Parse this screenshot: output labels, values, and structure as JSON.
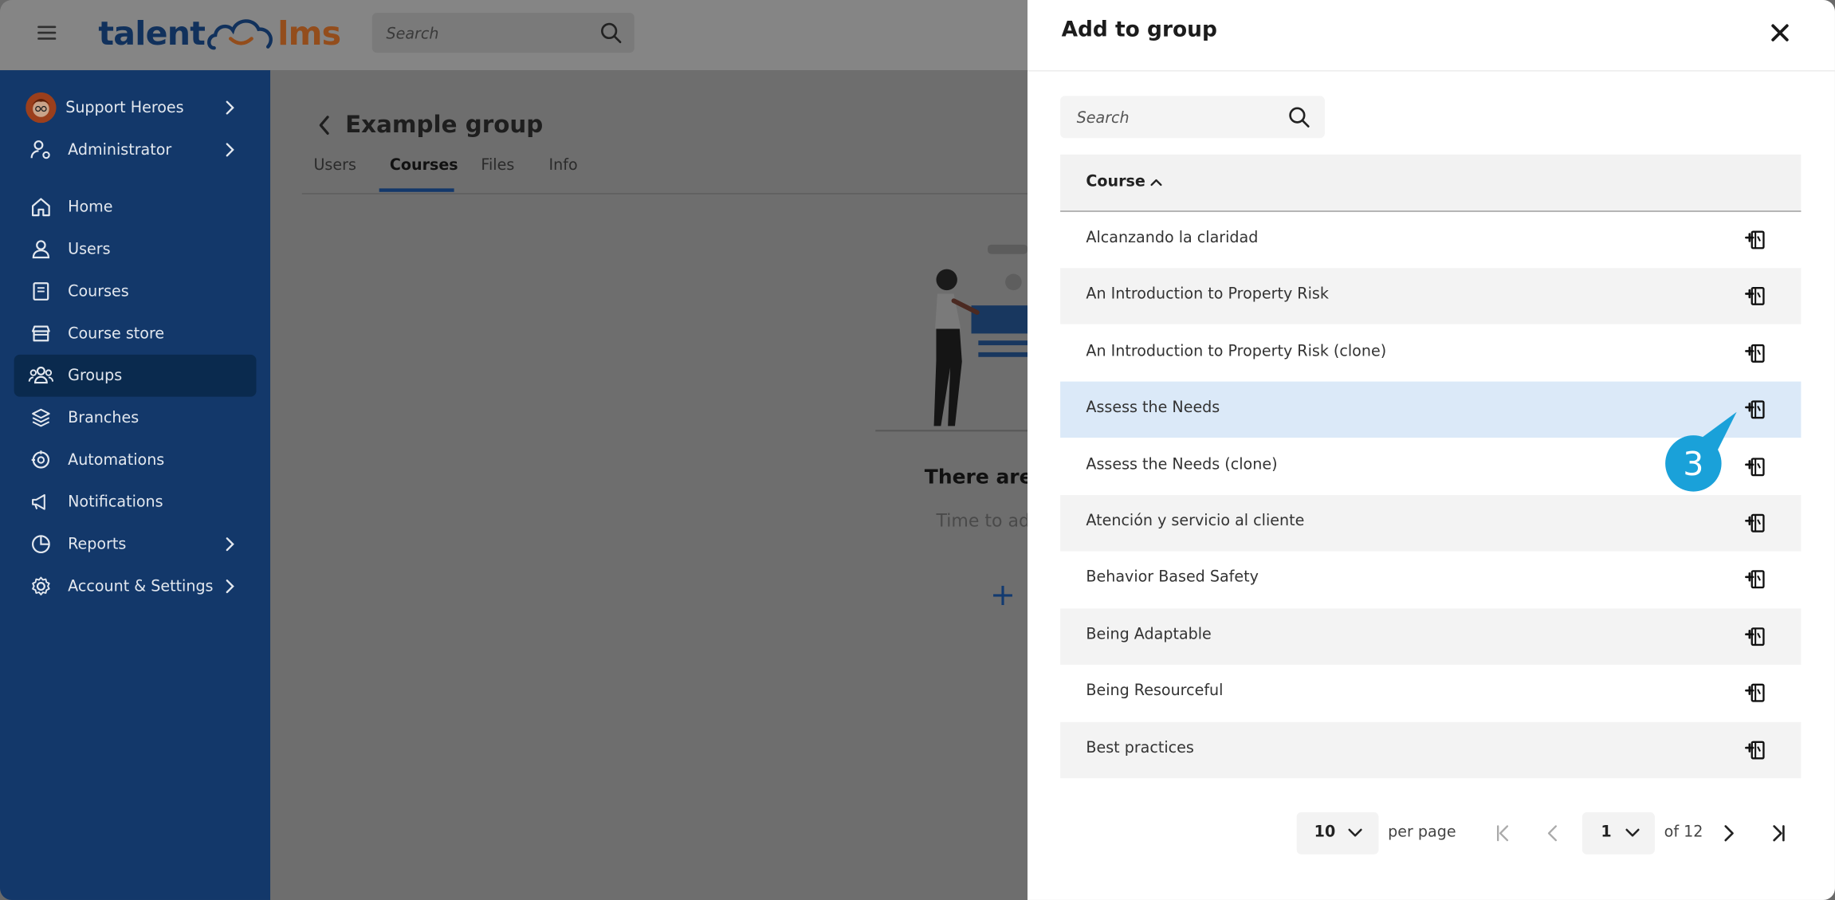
{
  "topbar": {
    "logo_talent": "talent",
    "logo_lms": "lms",
    "search_placeholder": "Search"
  },
  "sidebar": {
    "items": [
      {
        "label": "Support Heroes",
        "icon": "avatar",
        "chevron": true
      },
      {
        "label": "Administrator",
        "icon": "user-gear-icon",
        "chevron": true
      },
      {
        "label": "Home",
        "icon": "home-icon",
        "chevron": false
      },
      {
        "label": "Users",
        "icon": "user-icon",
        "chevron": false
      },
      {
        "label": "Courses",
        "icon": "book-icon",
        "chevron": false
      },
      {
        "label": "Course store",
        "icon": "store-icon",
        "chevron": false
      },
      {
        "label": "Groups",
        "icon": "groups-icon",
        "chevron": false,
        "active": true
      },
      {
        "label": "Branches",
        "icon": "layers-icon",
        "chevron": false
      },
      {
        "label": "Automations",
        "icon": "automation-icon",
        "chevron": false
      },
      {
        "label": "Notifications",
        "icon": "megaphone-icon",
        "chevron": false
      },
      {
        "label": "Reports",
        "icon": "pie-chart-icon",
        "chevron": true
      },
      {
        "label": "Account & Settings",
        "icon": "settings-icon",
        "chevron": true
      }
    ]
  },
  "main": {
    "title": "Example group",
    "tabs": [
      {
        "label": "Users",
        "active": false
      },
      {
        "label": "Courses",
        "active": true
      },
      {
        "label": "Files",
        "active": false
      },
      {
        "label": "Info",
        "active": false
      }
    ],
    "empty_title": "There are",
    "empty_subtitle": "Time to ad",
    "add_symbol": "+"
  },
  "panel": {
    "title": "Add to group",
    "search_placeholder": "Search",
    "column_header": "Course",
    "sort": "ascending",
    "rows": [
      {
        "label": "Alcanzando la claridad"
      },
      {
        "label": "An Introduction to Property Risk"
      },
      {
        "label": "An Introduction to Property Risk (clone)"
      },
      {
        "label": "Assess the Needs",
        "highlighted": true
      },
      {
        "label": "Assess the Needs (clone)"
      },
      {
        "label": "Atención y servicio al cliente"
      },
      {
        "label": "Behavior Based Safety"
      },
      {
        "label": "Being Adaptable"
      },
      {
        "label": "Being Resourceful"
      },
      {
        "label": "Best practices"
      }
    ],
    "row_action_icon": "add-to-group-icon",
    "annotation_badge": "3",
    "pager": {
      "per_page_value": "10",
      "per_page_label": "per page",
      "current_page": "1",
      "total_label": "of 12"
    }
  },
  "colors": {
    "sidebar": "#13386a",
    "sidebar_active": "#0a2a4e",
    "highlight_row": "#dbe9f8",
    "badge": "#1aa1d9"
  }
}
